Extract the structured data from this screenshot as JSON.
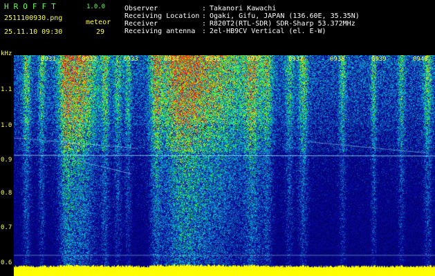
{
  "header": {
    "app_name": "HROFFT",
    "version": "1.0.0",
    "filename": "2511100930.png",
    "datetime": "25.11.10 09:30",
    "meteor_label": "meteor",
    "meteor_count": "29"
  },
  "info": {
    "observer_label": "Observer",
    "observer_value": "Takanori Kawachi",
    "location_label": "Receiving Location",
    "location_value": "Ogaki, Gifu, JAPAN (136.60E, 35.35N)",
    "receiver_label": "Receiver",
    "receiver_value": "R820T2(RTL-SDR) SDR-Sharp 53.372MHz",
    "antenna_label": "Receiving antenna",
    "antenna_value": "2el-HB9CV Vertical (el. E-W)",
    "colon": ":"
  },
  "axes": {
    "y_unit": "kHz",
    "y_ticks": [
      "1.1",
      "1.0",
      "0.9",
      "0.8",
      "0.7",
      "0.6"
    ],
    "x_ticks": [
      "0931",
      "0932",
      "0933",
      "0934",
      "0935",
      "0936",
      "0937",
      "0938",
      "0939",
      "0940"
    ]
  },
  "colors": {
    "label_green": "#6bff5a",
    "axis_yellow": "#ffff4a",
    "background": "#000000",
    "field_dark_blue": "#0a0a6e"
  }
}
